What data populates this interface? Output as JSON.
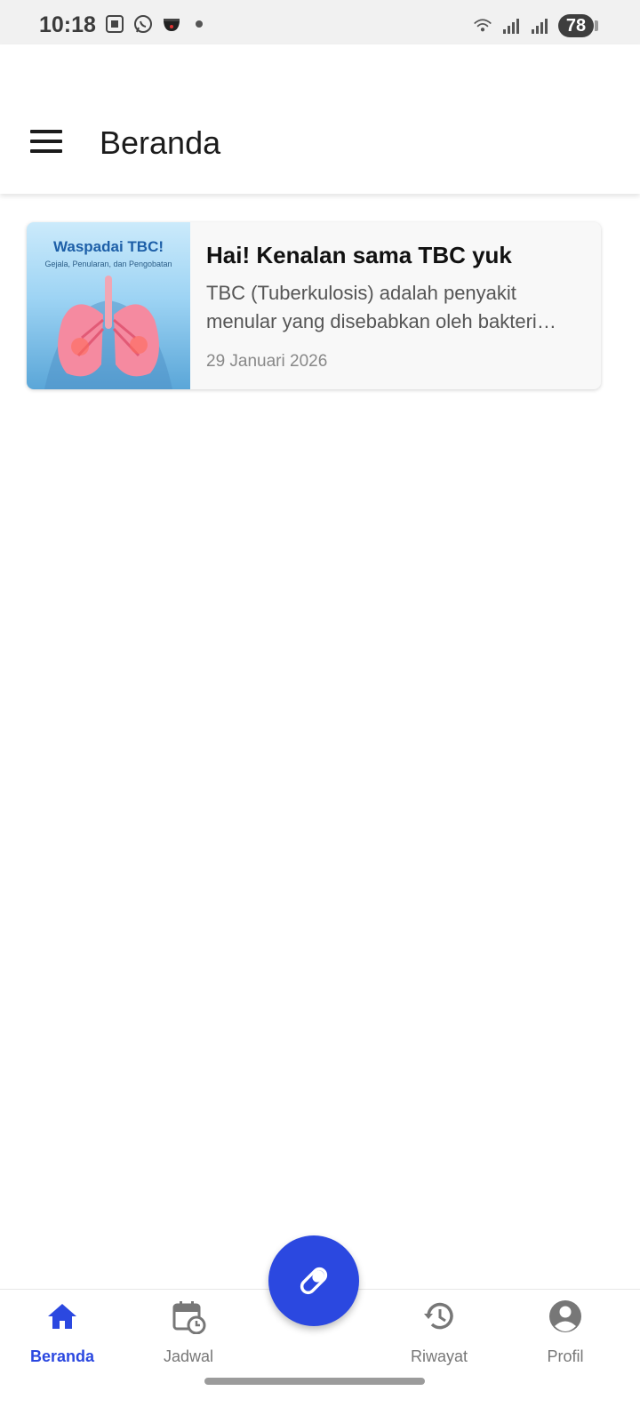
{
  "status_bar": {
    "time": "10:18",
    "battery": "78"
  },
  "appbar": {
    "title": "Beranda"
  },
  "articles": [
    {
      "thumbnail_title": "Waspadai TBC!",
      "thumbnail_subtitle": "Gejala, Penularan, dan Pengobatan",
      "title": "Hai! Kenalan sama TBC yuk",
      "excerpt": "TBC (Tuberkulosis) adalah penyakit menular yang disebabkan oleh bakteri Mycobacterium tuberculosis",
      "date": "29 Januari 2026"
    }
  ],
  "bottom_nav": {
    "items": [
      {
        "label": "Beranda",
        "icon": "home-icon",
        "active": true
      },
      {
        "label": "Jadwal",
        "icon": "calendar-clock-icon",
        "active": false
      },
      {
        "label": "Riwayat",
        "icon": "history-icon",
        "active": false
      },
      {
        "label": "Profil",
        "icon": "account-circle-icon",
        "active": false
      }
    ]
  },
  "fab": {
    "icon": "pill-icon"
  },
  "colors": {
    "accent": "#2b48e0",
    "nav_inactive": "#777777",
    "status_bar_bg": "#f1f1f1"
  }
}
